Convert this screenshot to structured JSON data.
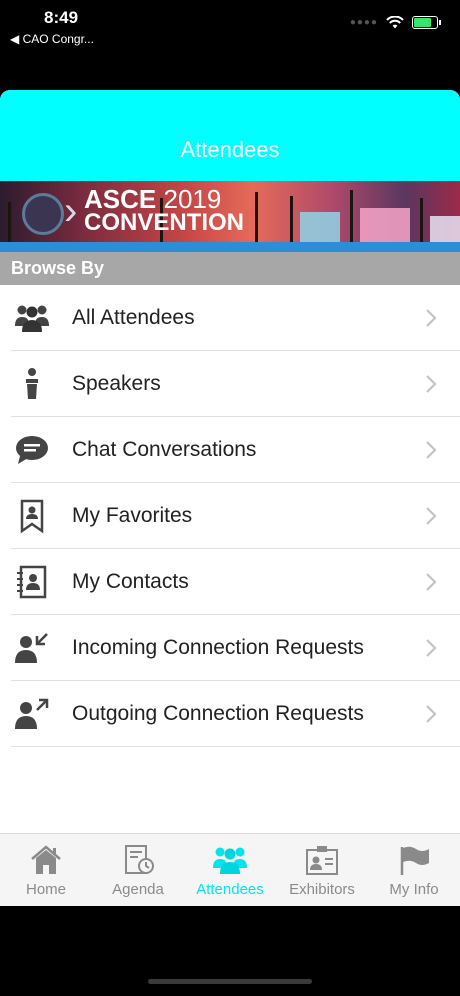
{
  "status_bar": {
    "time": "8:49",
    "back_app": "◀ CAO Congr..."
  },
  "header": {
    "title": "Attendees"
  },
  "banner": {
    "line1_brand": "ASCE",
    "line1_year": "2019",
    "line2": "CONVENTION"
  },
  "section": {
    "title": "Browse By"
  },
  "items": [
    {
      "label": "All Attendees",
      "icon": "group-icon"
    },
    {
      "label": "Speakers",
      "icon": "speaker-podium-icon"
    },
    {
      "label": "Chat Conversations",
      "icon": "chat-bubble-icon"
    },
    {
      "label": "My Favorites",
      "icon": "favorite-bookmark-icon"
    },
    {
      "label": "My Contacts",
      "icon": "contact-book-icon"
    },
    {
      "label": "Incoming Connection Requests",
      "icon": "incoming-request-icon"
    },
    {
      "label": "Outgoing Connection Requests",
      "icon": "outgoing-request-icon"
    }
  ],
  "tabs": [
    {
      "label": "Home",
      "icon": "home-icon"
    },
    {
      "label": "Agenda",
      "icon": "agenda-icon"
    },
    {
      "label": "Attendees",
      "icon": "attendees-icon",
      "active": true
    },
    {
      "label": "Exhibitors",
      "icon": "exhibitors-icon"
    },
    {
      "label": "My Info",
      "icon": "flag-icon"
    }
  ],
  "colors": {
    "header": "#00ffff",
    "active_tab": "#00e5ee",
    "section_header": "#a7a7a7",
    "accent_strip": "#2b8ed6"
  }
}
